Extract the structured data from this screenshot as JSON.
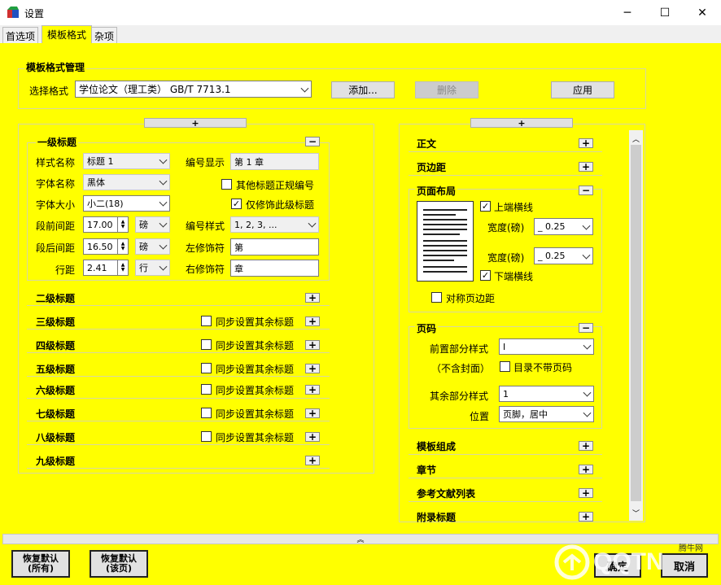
{
  "window": {
    "title": "设置",
    "minimize": "─",
    "maximize": "☐",
    "close": "✕"
  },
  "tabs": [
    "首选项",
    "模板格式",
    "杂项"
  ],
  "fmt": {
    "title": "模板格式管理",
    "select_label": "选择格式",
    "selected": "学位论文（理工类） GB/T 7713.1",
    "add": "添加...",
    "delete": "删除",
    "apply": "应用"
  },
  "expand": "+",
  "collapse": "−",
  "left": {
    "h1": {
      "title": "一级标题",
      "style_name_label": "样式名称",
      "style_name": "标题 1",
      "number_label": "编号显示",
      "number": "第 1 章",
      "font_name_label": "字体名称",
      "font_name": "黑体",
      "other_label": "其他标题正规编号",
      "font_size_label": "字体大小",
      "font_size": "小二(18)",
      "only_label": "仅修饰此级标题",
      "before_label": "段前间距",
      "before": "17.00",
      "unit_pt": "磅",
      "num_style_label": "编号样式",
      "num_style": "1, 2, 3, ...",
      "after_label": "段后间距",
      "after": "16.50",
      "left_deco_label": "左修饰符",
      "left_deco": "第",
      "line_label": "行距",
      "line": "2.41",
      "unit_line": "行",
      "right_deco_label": "右修饰符",
      "right_deco": "章"
    },
    "sync": "同步设置其余标题",
    "levels": [
      "二级标题",
      "三级标题",
      "四级标题",
      "五级标题",
      "六级标题",
      "七级标题",
      "八级标题",
      "九级标题"
    ]
  },
  "right": {
    "body": "正文",
    "margin": "页边距",
    "layout": "页面布局",
    "top_rule": "上端横线",
    "width_label": "宽度(磅)",
    "top_width": "_ 0.25",
    "bottom_width": "_ 0.25",
    "bottom_rule": "下端横线",
    "sym": "对称页边距",
    "pagenum": "页码",
    "front_label": "前置部分样式",
    "front": "I",
    "no_cover": "（不含封面）",
    "toc_no_num": "目录不带页码",
    "rest_label": "其余部分样式",
    "rest": "1",
    "pos_label": "位置",
    "pos": "页脚，居中",
    "tpl": "模板组成",
    "chapter": "章节",
    "refs": "参考文献列表",
    "appendix": "附录标题"
  },
  "bottom": {
    "reset_all_1": "恢复默认",
    "reset_all_2": "(所有)",
    "reset_page_1": "恢复默认",
    "reset_page_2": "(该页)",
    "ok": "确定",
    "cancel": "取消",
    "collapse": "︽"
  },
  "watermark": "腾牛网"
}
